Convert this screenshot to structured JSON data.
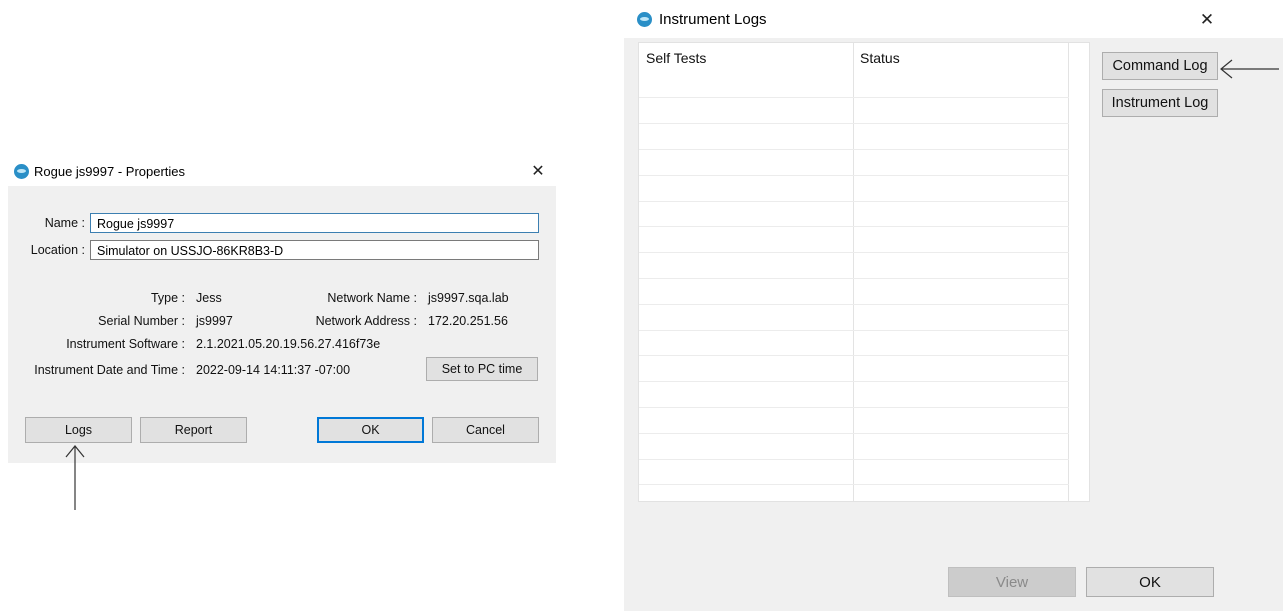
{
  "properties_dialog": {
    "title": "Rogue js9997 - Properties",
    "name_label": "Name :",
    "name_value": "Rogue js9997",
    "location_label": "Location :",
    "location_value": "Simulator on USSJO-86KR8B3-D",
    "type_label": "Type :",
    "type_value": "Jess",
    "serial_label": "Serial Number :",
    "serial_value": "js9997",
    "software_label": "Instrument Software :",
    "software_value": "2.1.2021.05.20.19.56.27.416f73e",
    "datetime_label": "Instrument Date and Time :",
    "datetime_value": "2022-09-14 14:11:37 -07:00",
    "network_name_label": "Network Name :",
    "network_name_value": "js9997.sqa.lab",
    "network_address_label": "Network Address :",
    "network_address_value": "172.20.251.56",
    "set_pc_time_label": "Set to PC time",
    "logs_label": "Logs",
    "report_label": "Report",
    "ok_label": "OK",
    "cancel_label": "Cancel",
    "close_glyph": "✕"
  },
  "logs_dialog": {
    "title": "Instrument Logs",
    "col_self_tests": "Self Tests",
    "col_status": "Status",
    "command_log_label": "Command Log",
    "instrument_log_label": "Instrument Log",
    "view_label": "View",
    "ok_label": "OK",
    "close_glyph": "✕"
  },
  "icons": {
    "app": "sw-app-icon",
    "arrow_up": "arrow-up-annotation",
    "arrow_left": "arrow-left-annotation"
  },
  "colors": {
    "dialog_bg": "#f0f0f0",
    "accent": "#0078d7",
    "icon_blue": "#2a8fc7"
  }
}
